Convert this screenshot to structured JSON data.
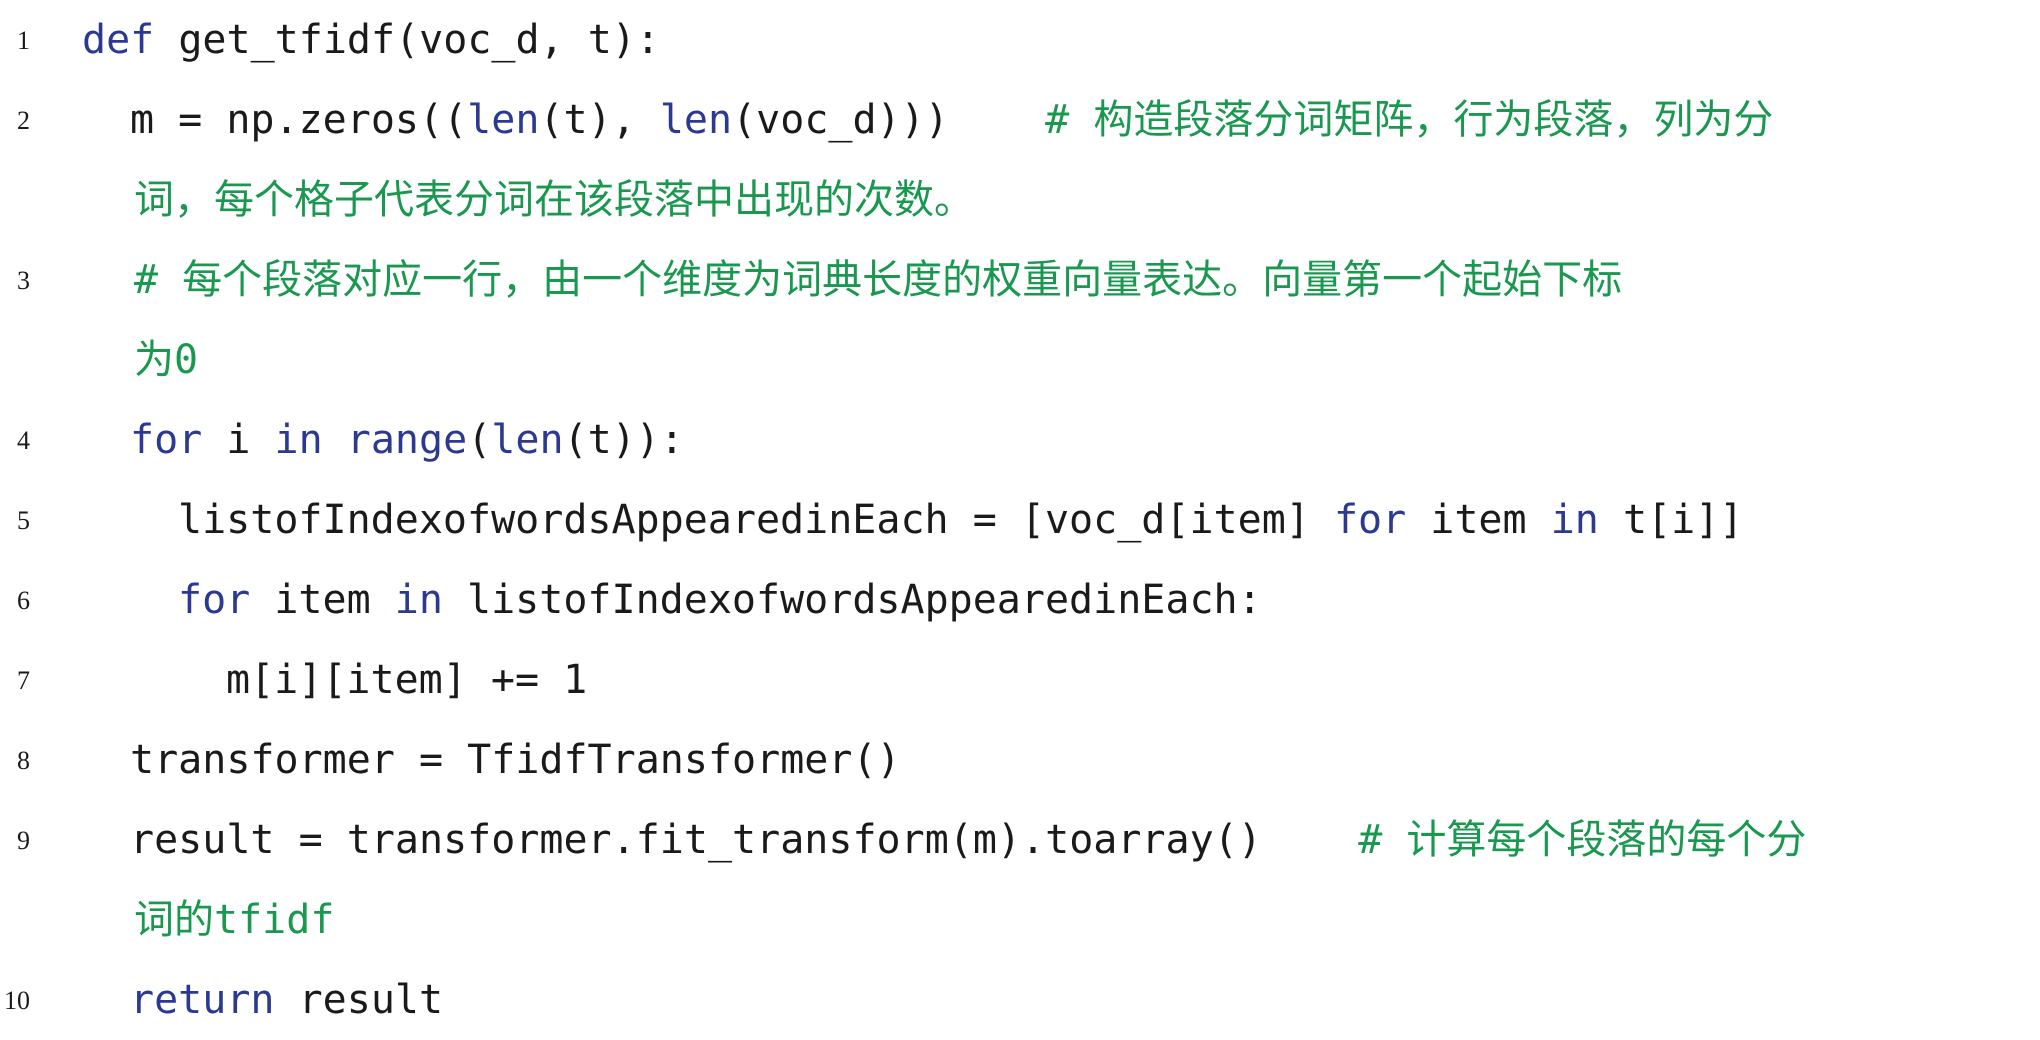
{
  "lines": [
    {
      "no": "1",
      "segments": [
        {
          "t": "def",
          "k": "kw"
        },
        {
          "t": " get_tfidf(voc_d, t):",
          "k": "tx"
        }
      ]
    },
    {
      "no": "2",
      "segments": [
        {
          "t": "m = np.zeros((",
          "k": "tx"
        },
        {
          "t": "len",
          "k": "kw"
        },
        {
          "t": "(t), ",
          "k": "tx"
        },
        {
          "t": "len",
          "k": "kw"
        },
        {
          "t": "(voc_d)))    ",
          "k": "tx"
        },
        {
          "t": "# 构造段落分词矩阵，行为段落，列为分",
          "k": "cm"
        }
      ],
      "wrap": "词，每个格子代表分词在该段落中出现的次数。"
    },
    {
      "no": "3",
      "segments": [
        {
          "t": "# 每个段落对应一行，由一个维度为词典长度的权重向量表达。向量第一个起始下标",
          "k": "cm"
        }
      ],
      "wrap": "为0"
    },
    {
      "no": "4",
      "segments": [
        {
          "t": "for",
          "k": "kw"
        },
        {
          "t": " i ",
          "k": "tx"
        },
        {
          "t": "in",
          "k": "kw"
        },
        {
          "t": " ",
          "k": "tx"
        },
        {
          "t": "range",
          "k": "kw"
        },
        {
          "t": "(",
          "k": "tx"
        },
        {
          "t": "len",
          "k": "kw"
        },
        {
          "t": "(t)):",
          "k": "tx"
        }
      ]
    },
    {
      "no": "5",
      "segments": [
        {
          "t": "listofIndexofwordsAppearedinEach = [voc_d[item] ",
          "k": "tx"
        },
        {
          "t": "for",
          "k": "kw"
        },
        {
          "t": " item ",
          "k": "tx"
        },
        {
          "t": "in",
          "k": "kw"
        },
        {
          "t": " t[i]]",
          "k": "tx"
        }
      ]
    },
    {
      "no": "6",
      "segments": [
        {
          "t": "for",
          "k": "kw"
        },
        {
          "t": " item ",
          "k": "tx"
        },
        {
          "t": "in",
          "k": "kw"
        },
        {
          "t": " listofIndexofwordsAppearedinEach:",
          "k": "tx"
        }
      ]
    },
    {
      "no": "7",
      "segments": [
        {
          "t": "m[i][item] += 1",
          "k": "tx"
        }
      ]
    },
    {
      "no": "8",
      "segments": [
        {
          "t": "transformer = TfidfTransformer()",
          "k": "tx"
        }
      ]
    },
    {
      "no": "9",
      "segments": [
        {
          "t": "result = transformer.fit_transform(m).toarray()    ",
          "k": "tx"
        },
        {
          "t": "# 计算每个段落的每个分",
          "k": "cm"
        }
      ],
      "wrap": "词的tfidf"
    },
    {
      "no": "10",
      "segments": [
        {
          "t": "return",
          "k": "kw"
        },
        {
          "t": " result",
          "k": "tx"
        }
      ]
    }
  ],
  "colors": {
    "keyword": "#2b3990",
    "comment": "#1a9850",
    "text": "#1a1a1a"
  }
}
